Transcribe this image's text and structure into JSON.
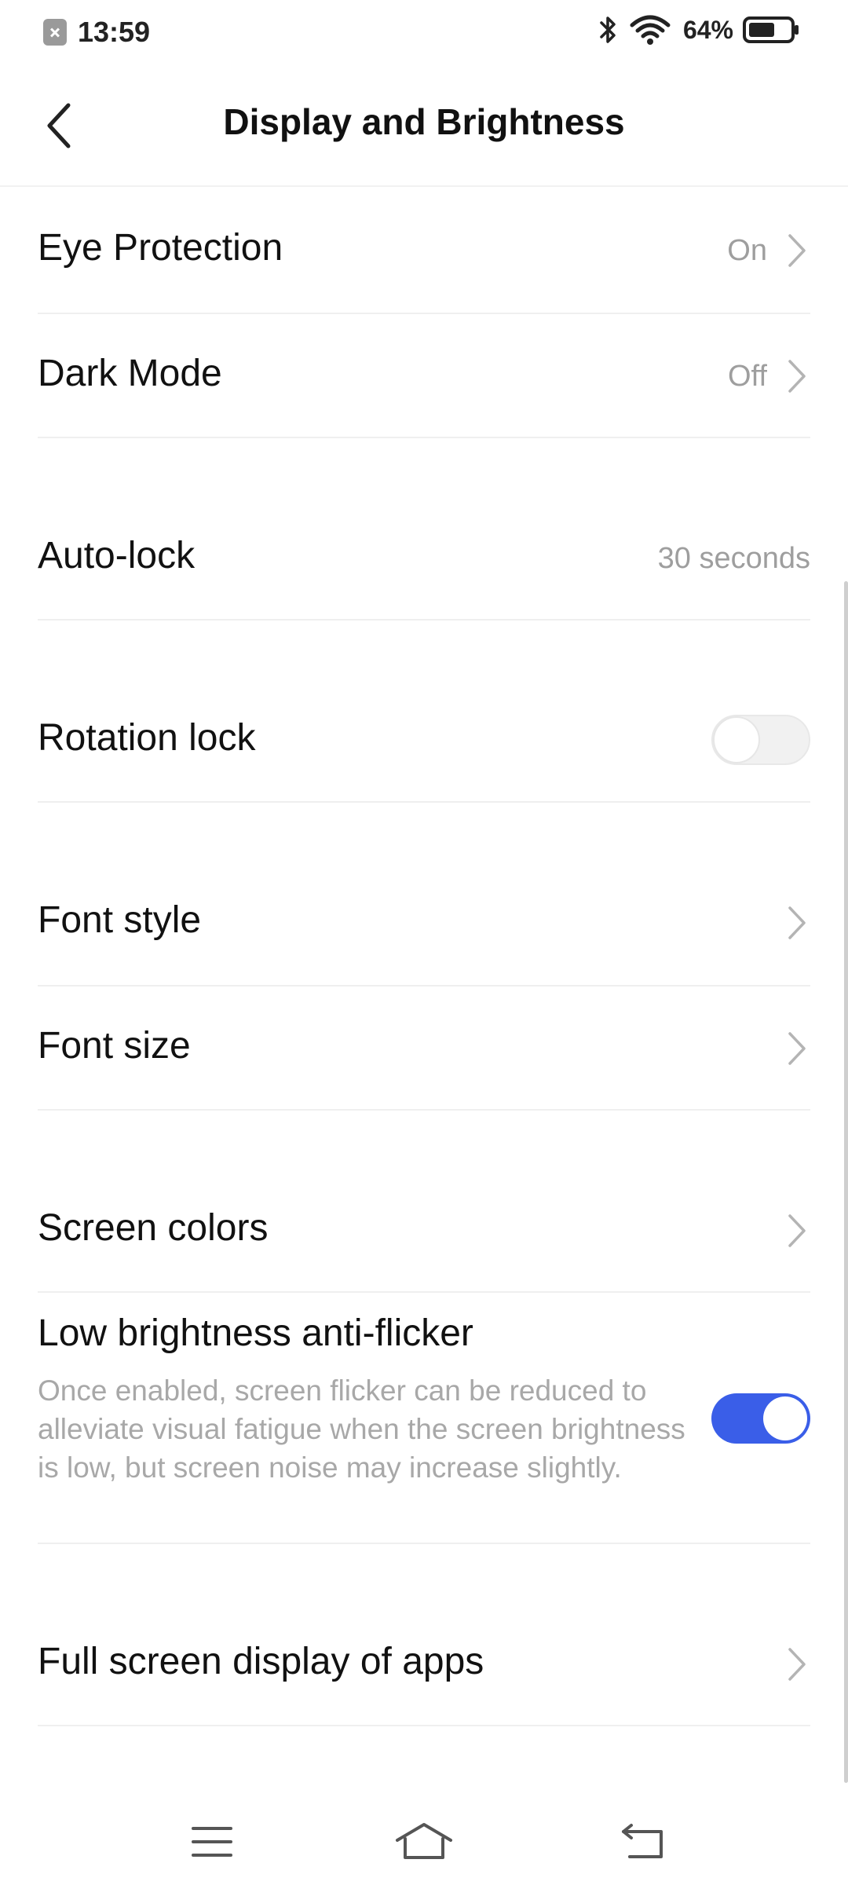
{
  "status_bar": {
    "time": "13:59",
    "battery_percent": "64%",
    "battery_level": 0.64
  },
  "header": {
    "title": "Display and Brightness"
  },
  "settings": {
    "eye_protection": {
      "label": "Eye Protection",
      "value": "On"
    },
    "dark_mode": {
      "label": "Dark Mode",
      "value": "Off"
    },
    "auto_lock": {
      "label": "Auto-lock",
      "value": "30 seconds"
    },
    "rotation_lock": {
      "label": "Rotation lock",
      "enabled": false
    },
    "font_style": {
      "label": "Font style"
    },
    "font_size": {
      "label": "Font size"
    },
    "screen_colors": {
      "label": "Screen colors"
    },
    "low_brightness_anti_flicker": {
      "label": "Low brightness anti-flicker",
      "description": "Once enabled, screen flicker can be reduced to alleviate visual fatigue when the screen brightness is low, but screen noise may increase slightly.",
      "enabled": true
    },
    "full_screen_display": {
      "label": "Full screen display of apps"
    }
  },
  "colors": {
    "accent": "#3a5ee8",
    "secondary_text": "#9e9e9e",
    "divider": "#efefef"
  },
  "icons": {
    "back": "back-arrow-icon",
    "chevron": "chevron-right-icon",
    "nav_menu": "menu-icon",
    "nav_home": "home-icon",
    "nav_back": "back-icon"
  }
}
